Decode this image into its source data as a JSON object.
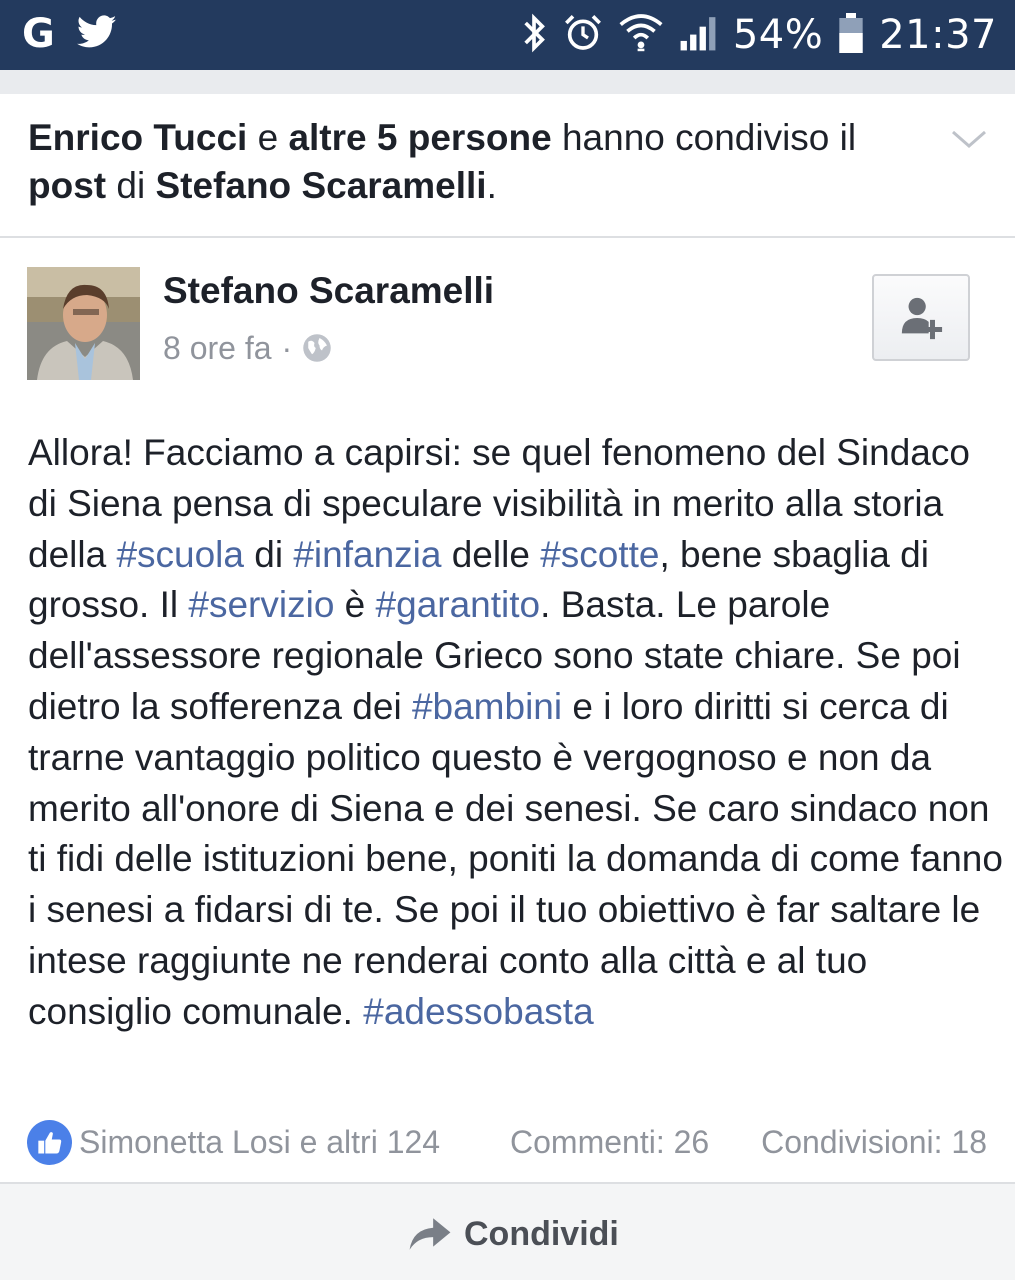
{
  "status_bar": {
    "left_icons": [
      "google-icon",
      "twitter-icon"
    ],
    "right_icons": [
      "bluetooth-icon",
      "alarm-icon",
      "wifi-icon",
      "signal-icon",
      "battery-icon"
    ],
    "google_glyph": "G",
    "battery_percent": "54%",
    "time": "21:37"
  },
  "shared_header": {
    "actor": "Enrico Tucci",
    "connector": "e",
    "others": "altre 5 persone",
    "verb": "hanno condiviso il",
    "object": "post",
    "preposition": "di",
    "owner": "Stefano Scaramelli",
    "end": "."
  },
  "post": {
    "author": "Stefano Scaramelli",
    "time": "8 ore fa",
    "dot": "·",
    "privacy_icon": "globe-icon",
    "body_segments": [
      {
        "text": "Allora! Facciamo a capirsi: se quel fenomeno del Sindaco di Siena pensa di speculare visibilità in merito alla storia della ",
        "tag": false
      },
      {
        "text": "#scuola",
        "tag": true
      },
      {
        "text": " di ",
        "tag": false
      },
      {
        "text": "#infanzia",
        "tag": true
      },
      {
        "text": " delle ",
        "tag": false
      },
      {
        "text": "#scotte",
        "tag": true
      },
      {
        "text": ", bene sbaglia di grosso. Il ",
        "tag": false
      },
      {
        "text": "#servizio",
        "tag": true
      },
      {
        "text": " è ",
        "tag": false
      },
      {
        "text": "#garantito",
        "tag": true
      },
      {
        "text": ". Basta. Le parole dell'assessore regionale Grieco sono state chiare. Se poi dietro la sofferenza dei ",
        "tag": false
      },
      {
        "text": "#bambini",
        "tag": true
      },
      {
        "text": " e i loro diritti si cerca di trarne vantaggio politico questo è vergognoso e non da merito all'onore di Siena e dei senesi. Se caro sindaco non ti fidi delle istituzioni bene, poniti la domanda di come fanno i senesi a fidarsi di te. Se poi il tuo obiettivo è far saltare le intese raggiunte ne renderai conto alla città e al tuo consiglio comunale. ",
        "tag": false
      },
      {
        "text": "#adessobasta",
        "tag": true
      }
    ]
  },
  "stats": {
    "likes": "Simonetta Losi e altri 124",
    "comments": "Commenti: 26",
    "shares": "Condivisioni: 18"
  },
  "actions": {
    "share_label": "Condividi"
  },
  "colors": {
    "status_bar": "#233a5e",
    "hashtag": "#4b67a1",
    "like_blue": "#4b80e8",
    "muted_text": "#90949c"
  }
}
